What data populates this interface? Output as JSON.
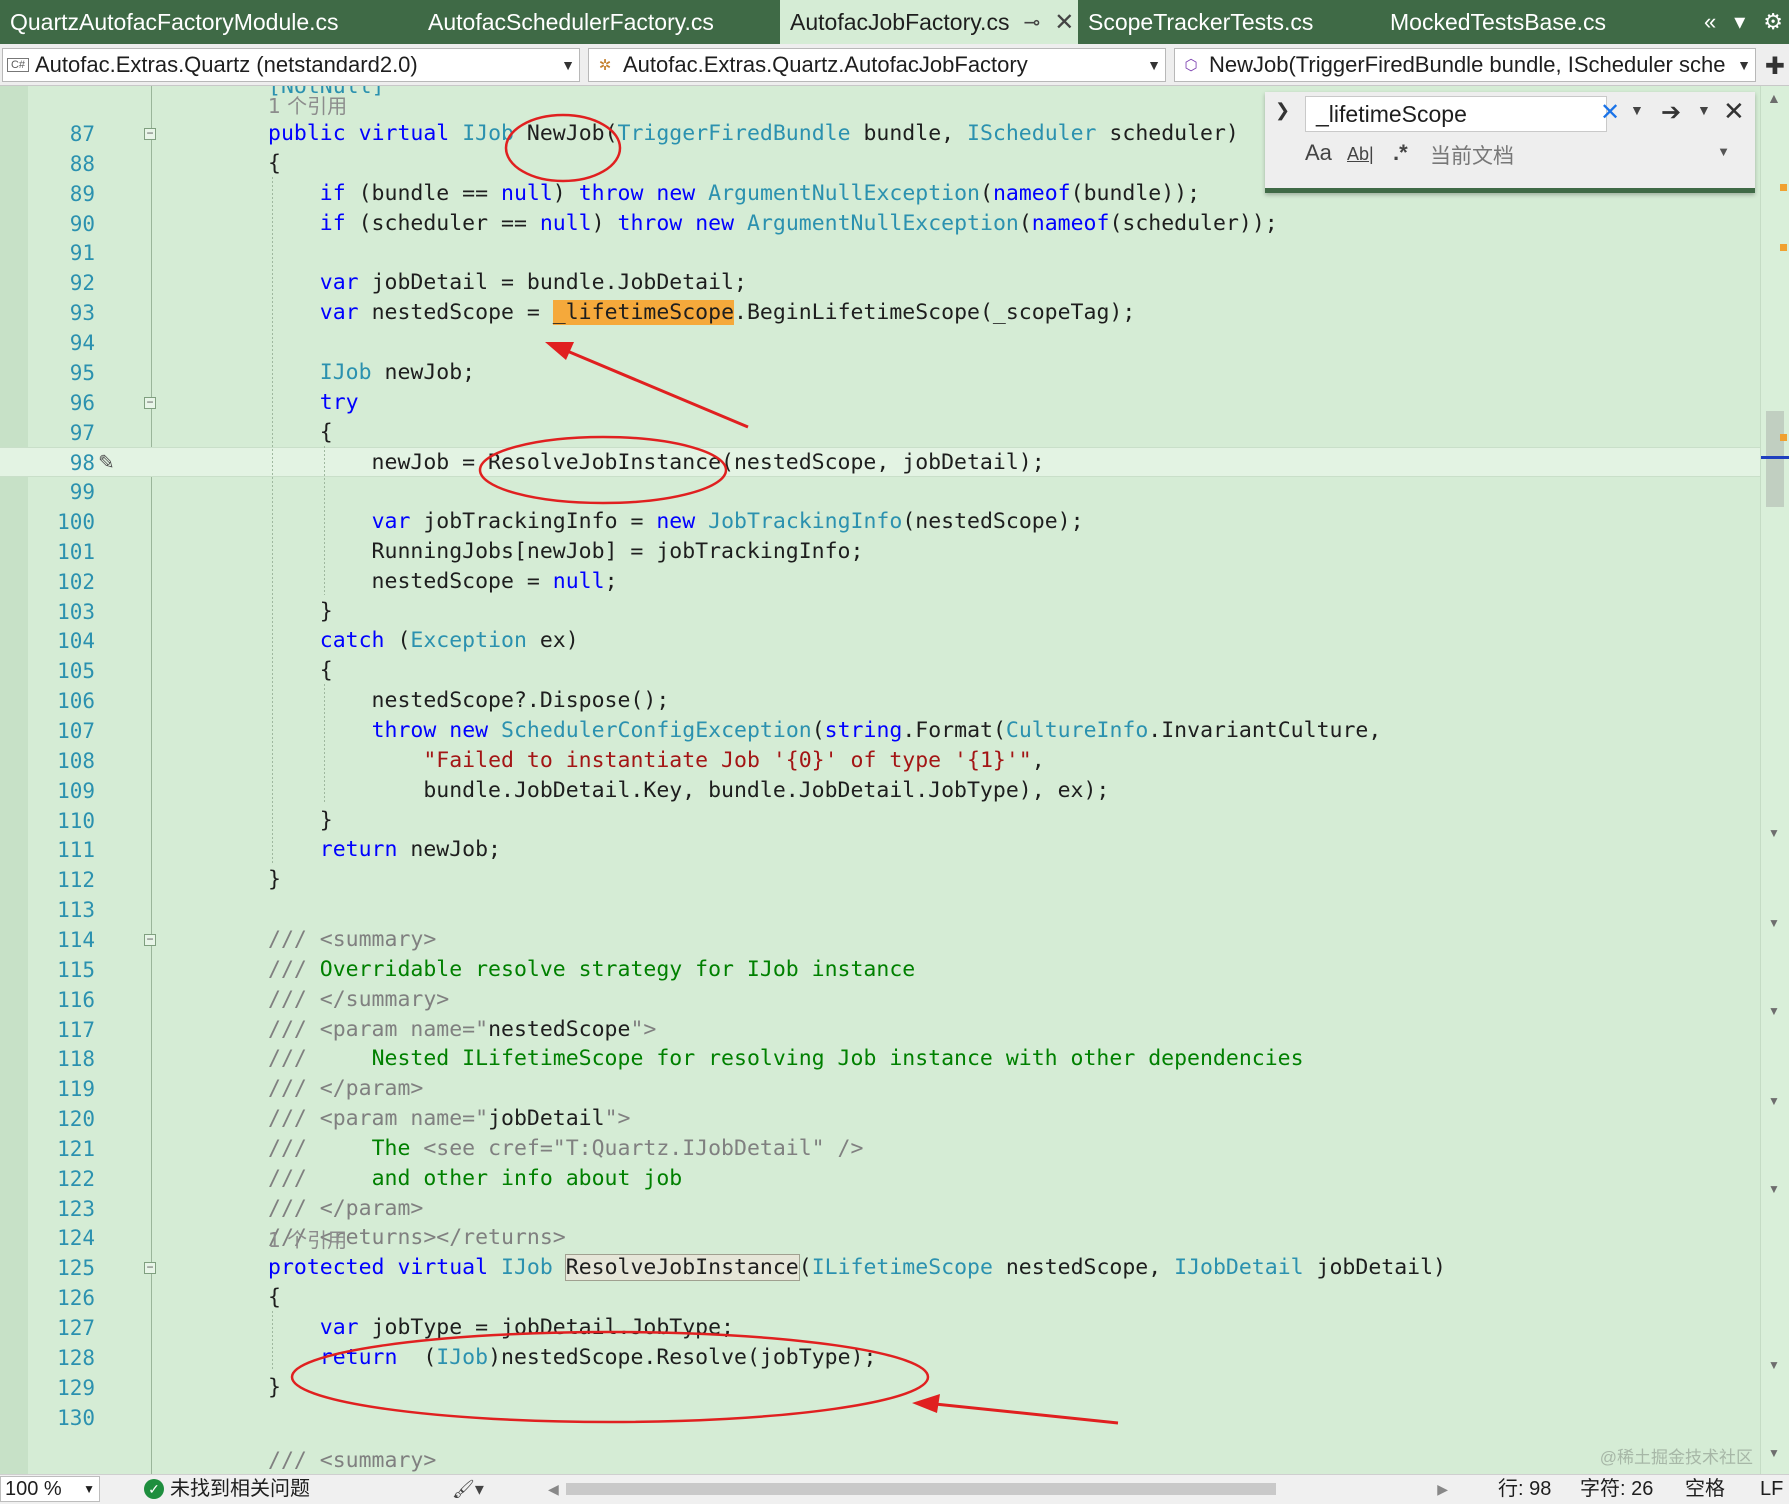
{
  "tabs": [
    {
      "label": "QuartzAutofacFactoryModule.cs",
      "active": false
    },
    {
      "label": "AutofacSchedulerFactory.cs",
      "active": false
    },
    {
      "label": "AutofacJobFactory.cs",
      "active": true
    },
    {
      "label": "ScopeTrackerTests.cs",
      "active": false
    },
    {
      "label": "MockedTestsBase.cs",
      "active": false
    }
  ],
  "tab_controls": {
    "scroll_icon": "«",
    "dropdown_icon": "▾",
    "settings_icon": "⚙"
  },
  "navbar": {
    "project": "Autofac.Extras.Quartz (netstandard2.0)",
    "project_icon": "C#",
    "type": "Autofac.Extras.Quartz.AutofacJobFactory",
    "member": "NewJob(TriggerFiredBundle bundle, IScheduler sche"
  },
  "find": {
    "query": "_lifetimeScope",
    "scope": "当前文档",
    "match_case_icon": "Aa",
    "whole_word_icon": "Ab|",
    "regex_icon": ".*"
  },
  "editor": {
    "colors": {
      "background": "#d5ecd5",
      "keyword": "#0000ff",
      "type": "#2b91af",
      "string": "#a31515",
      "comment": "#008000",
      "find_highlight": "#f5a93b",
      "annotation_red": "#e02020"
    },
    "partial_top_text": "[NotNull]",
    "partial_bottom_text": "/// <summary>",
    "lines": [
      {
        "n": "87",
        "ref": "1 个引用",
        "tokens": [
          [
            "kw",
            "public"
          ],
          [
            "",
            "",
            " "
          ],
          [
            "kw",
            "virtual"
          ],
          [
            "",
            " "
          ],
          [
            "ty",
            "IJob"
          ],
          [
            "",
            " NewJob("
          ],
          [
            "ty",
            "TriggerFiredBundle"
          ],
          [
            "",
            " bundle, "
          ],
          [
            "ty",
            "IScheduler"
          ],
          [
            "",
            " scheduler)"
          ]
        ],
        "fold": true
      },
      {
        "n": "88",
        "tokens": [
          [
            "",
            "{"
          ]
        ]
      },
      {
        "n": "89",
        "tokens": [
          [
            "",
            "    "
          ],
          [
            "kw",
            "if"
          ],
          [
            "",
            " (bundle == "
          ],
          [
            "kw",
            "null"
          ],
          [
            "",
            ") "
          ],
          [
            "kw",
            "throw"
          ],
          [
            "",
            " "
          ],
          [
            "kw",
            "new"
          ],
          [
            "",
            " "
          ],
          [
            "ty",
            "ArgumentNullException"
          ],
          [
            "",
            "("
          ],
          [
            "kw",
            "nameof"
          ],
          [
            "",
            "(bundle));"
          ]
        ]
      },
      {
        "n": "90",
        "tokens": [
          [
            "",
            "    "
          ],
          [
            "kw",
            "if"
          ],
          [
            "",
            " (scheduler == "
          ],
          [
            "kw",
            "null"
          ],
          [
            "",
            ") "
          ],
          [
            "kw",
            "throw"
          ],
          [
            "",
            " "
          ],
          [
            "kw",
            "new"
          ],
          [
            "",
            " "
          ],
          [
            "ty",
            "ArgumentNullException"
          ],
          [
            "",
            "("
          ],
          [
            "kw",
            "nameof"
          ],
          [
            "",
            "(scheduler));"
          ]
        ]
      },
      {
        "n": "91",
        "tokens": []
      },
      {
        "n": "92",
        "tokens": [
          [
            "",
            "    "
          ],
          [
            "kw",
            "var"
          ],
          [
            "",
            " jobDetail = bundle.JobDetail;"
          ]
        ]
      },
      {
        "n": "93",
        "tokens": [
          [
            "",
            "    "
          ],
          [
            "kw",
            "var"
          ],
          [
            "",
            " nestedScope = "
          ],
          [
            "find",
            "_lifetimeScope"
          ],
          [
            "",
            ".BeginLifetimeScope(_scopeTag);"
          ]
        ]
      },
      {
        "n": "94",
        "tokens": []
      },
      {
        "n": "95",
        "tokens": [
          [
            "",
            "    "
          ],
          [
            "ty",
            "IJob"
          ],
          [
            "",
            " newJob;"
          ]
        ]
      },
      {
        "n": "96",
        "tokens": [
          [
            "",
            "    "
          ],
          [
            "kw",
            "try"
          ]
        ],
        "fold": true
      },
      {
        "n": "97",
        "tokens": [
          [
            "",
            "    {"
          ]
        ]
      },
      {
        "n": "98",
        "tokens": [
          [
            "",
            "        newJob = ResolveJobInstance(nestedScope, jobDetail);"
          ]
        ],
        "current": true
      },
      {
        "n": "99",
        "tokens": []
      },
      {
        "n": "100",
        "tokens": [
          [
            "",
            "        "
          ],
          [
            "kw",
            "var"
          ],
          [
            "",
            " jobTrackingInfo = "
          ],
          [
            "kw",
            "new"
          ],
          [
            "",
            " "
          ],
          [
            "ty",
            "JobTrackingInfo"
          ],
          [
            "",
            "(nestedScope);"
          ]
        ]
      },
      {
        "n": "101",
        "tokens": [
          [
            "",
            "        RunningJobs[newJob] = jobTrackingInfo;"
          ]
        ]
      },
      {
        "n": "102",
        "tokens": [
          [
            "",
            "        nestedScope = "
          ],
          [
            "kw",
            "null"
          ],
          [
            "",
            ";"
          ]
        ]
      },
      {
        "n": "103",
        "tokens": [
          [
            "",
            "    }"
          ]
        ]
      },
      {
        "n": "104",
        "tokens": [
          [
            "",
            "    "
          ],
          [
            "kw",
            "catch"
          ],
          [
            "",
            " ("
          ],
          [
            "ty",
            "Exception"
          ],
          [
            "",
            " ex)"
          ]
        ]
      },
      {
        "n": "105",
        "tokens": [
          [
            "",
            "    {"
          ]
        ]
      },
      {
        "n": "106",
        "tokens": [
          [
            "",
            "        nestedScope?.Dispose();"
          ]
        ]
      },
      {
        "n": "107",
        "tokens": [
          [
            "",
            "        "
          ],
          [
            "kw",
            "throw"
          ],
          [
            "",
            " "
          ],
          [
            "kw",
            "new"
          ],
          [
            "",
            " "
          ],
          [
            "ty",
            "SchedulerConfigException"
          ],
          [
            "",
            "("
          ],
          [
            "kw",
            "string"
          ],
          [
            "",
            ".Format("
          ],
          [
            "ty",
            "CultureInfo"
          ],
          [
            "",
            ".InvariantCulture,"
          ]
        ]
      },
      {
        "n": "108",
        "tokens": [
          [
            "",
            "            "
          ],
          [
            "str",
            "\"Failed to instantiate Job '{0}' of type '{1}'\""
          ],
          [
            "",
            ","
          ]
        ]
      },
      {
        "n": "109",
        "tokens": [
          [
            "",
            "            bundle.JobDetail.Key, bundle.JobDetail.JobType), ex);"
          ]
        ]
      },
      {
        "n": "110",
        "tokens": [
          [
            "",
            "    }"
          ]
        ]
      },
      {
        "n": "111",
        "tokens": [
          [
            "",
            "    "
          ],
          [
            "kw",
            "return"
          ],
          [
            "",
            " newJob;"
          ]
        ]
      },
      {
        "n": "112",
        "tokens": [
          [
            "",
            "}"
          ]
        ]
      },
      {
        "n": "113",
        "tokens": []
      },
      {
        "n": "114",
        "tokens": [
          [
            "xm",
            "/// <summary>"
          ]
        ],
        "fold": true
      },
      {
        "n": "115",
        "tokens": [
          [
            "xm",
            "/// "
          ],
          [
            "cm",
            "Overridable resolve strategy for IJob instance"
          ]
        ]
      },
      {
        "n": "116",
        "tokens": [
          [
            "xm",
            "/// </summary>"
          ]
        ]
      },
      {
        "n": "117",
        "tokens": [
          [
            "xm",
            "/// <param name=\""
          ],
          [
            "",
            "nestedScope"
          ],
          [
            "xm",
            "\">"
          ]
        ]
      },
      {
        "n": "118",
        "tokens": [
          [
            "xm",
            "///     "
          ],
          [
            "cm",
            "Nested ILifetimeScope for resolving Job instance with other dependencies"
          ]
        ]
      },
      {
        "n": "119",
        "tokens": [
          [
            "xm",
            "/// </param>"
          ]
        ]
      },
      {
        "n": "120",
        "tokens": [
          [
            "xm",
            "/// <param name=\""
          ],
          [
            "",
            "jobDetail"
          ],
          [
            "xm",
            "\">"
          ]
        ]
      },
      {
        "n": "121",
        "tokens": [
          [
            "xm",
            "///     "
          ],
          [
            "cm",
            "The "
          ],
          [
            "xm",
            "<see cref=\"T:Quartz.IJobDetail\" />"
          ]
        ]
      },
      {
        "n": "122",
        "tokens": [
          [
            "xm",
            "///     "
          ],
          [
            "cm",
            "and other info about job"
          ]
        ]
      },
      {
        "n": "123",
        "tokens": [
          [
            "xm",
            "/// </param>"
          ]
        ]
      },
      {
        "n": "124",
        "tokens": [
          [
            "xm",
            "/// <returns></returns>"
          ]
        ]
      },
      {
        "n": "125",
        "ref": "1 个引用",
        "tokens": [
          [
            "kw",
            "protected"
          ],
          [
            "",
            " "
          ],
          [
            "kw",
            "virtual"
          ],
          [
            "",
            " "
          ],
          [
            "ty",
            "IJob"
          ],
          [
            "",
            " "
          ],
          [
            "def",
            "ResolveJobInstance"
          ],
          [
            "",
            "("
          ],
          [
            "ty",
            "ILifetimeScope"
          ],
          [
            "",
            " nestedScope, "
          ],
          [
            "ty",
            "IJobDetail"
          ],
          [
            "",
            " jobDetail)"
          ]
        ],
        "fold": true
      },
      {
        "n": "126",
        "tokens": [
          [
            "",
            "{"
          ]
        ]
      },
      {
        "n": "127",
        "tokens": [
          [
            "",
            "    "
          ],
          [
            "kw",
            "var"
          ],
          [
            "",
            " jobType = jobDetail.JobType;"
          ]
        ]
      },
      {
        "n": "128",
        "tokens": [
          [
            "",
            "    "
          ],
          [
            "kw",
            "return"
          ],
          [
            "",
            "  ("
          ],
          [
            "ty",
            "IJob"
          ],
          [
            "",
            ")nestedScope.Resolve(jobType);"
          ]
        ]
      },
      {
        "n": "129",
        "tokens": [
          [
            "",
            "}"
          ]
        ]
      },
      {
        "n": "130",
        "tokens": []
      }
    ]
  },
  "status": {
    "zoom": "100 %",
    "issues": "未找到相关问题",
    "line": "行: 98",
    "char": "字符: 26",
    "indent": "空格",
    "eol": "LF"
  },
  "watermark": "@稀土掘金技术社区"
}
